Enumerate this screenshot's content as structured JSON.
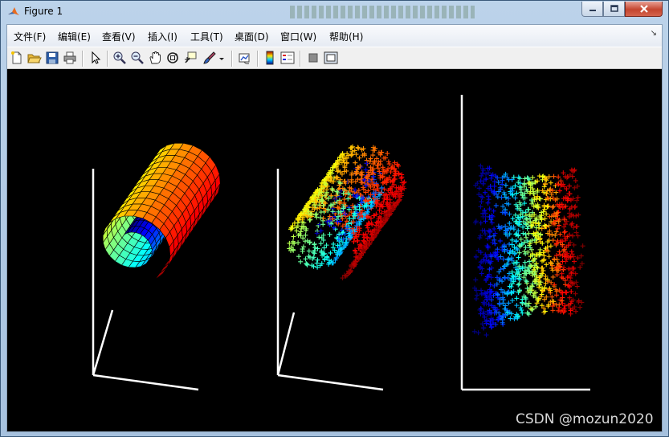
{
  "window": {
    "title": "Figure 1",
    "background_title": ""
  },
  "menu": [
    {
      "label": "文件(F)"
    },
    {
      "label": "编辑(E)"
    },
    {
      "label": "查看(V)"
    },
    {
      "label": "插入(I)"
    },
    {
      "label": "工具(T)"
    },
    {
      "label": "桌面(D)"
    },
    {
      "label": "窗口(W)"
    },
    {
      "label": "帮助(H)"
    }
  ],
  "toolbar": [
    {
      "icon": "new-figure-icon"
    },
    {
      "icon": "open-file-icon"
    },
    {
      "icon": "save-figure-icon"
    },
    {
      "icon": "print-figure-icon"
    },
    {
      "icon": "edit-plot-arrow-icon"
    },
    {
      "icon": "zoom-in-icon"
    },
    {
      "icon": "zoom-out-icon"
    },
    {
      "icon": "pan-hand-icon"
    },
    {
      "icon": "rotate-3d-icon"
    },
    {
      "icon": "data-cursor-icon"
    },
    {
      "icon": "brush-icon"
    },
    {
      "icon": "link-plot-icon"
    },
    {
      "icon": "insert-colorbar-icon"
    },
    {
      "icon": "insert-legend-icon"
    },
    {
      "icon": "hide-plot-tools-icon"
    },
    {
      "icon": "show-plot-tools-icon"
    }
  ],
  "colors": {
    "plot_background": "#000000",
    "axes": "#ffffff",
    "colormap": "jet"
  },
  "watermark": "CSDN @mozun2020",
  "chart_data": [
    {
      "type": "surface",
      "title": "",
      "xlabel": "",
      "ylabel": "",
      "zlabel": "",
      "colormap": "jet",
      "grid": false
    },
    {
      "type": "scatter",
      "marker": "+",
      "title": "",
      "xlabel": "",
      "ylabel": "",
      "zlabel": "",
      "colormap": "jet"
    },
    {
      "type": "scatter",
      "marker": "+",
      "title": "",
      "xlabel": "",
      "ylabel": "",
      "colormap": "jet"
    }
  ]
}
